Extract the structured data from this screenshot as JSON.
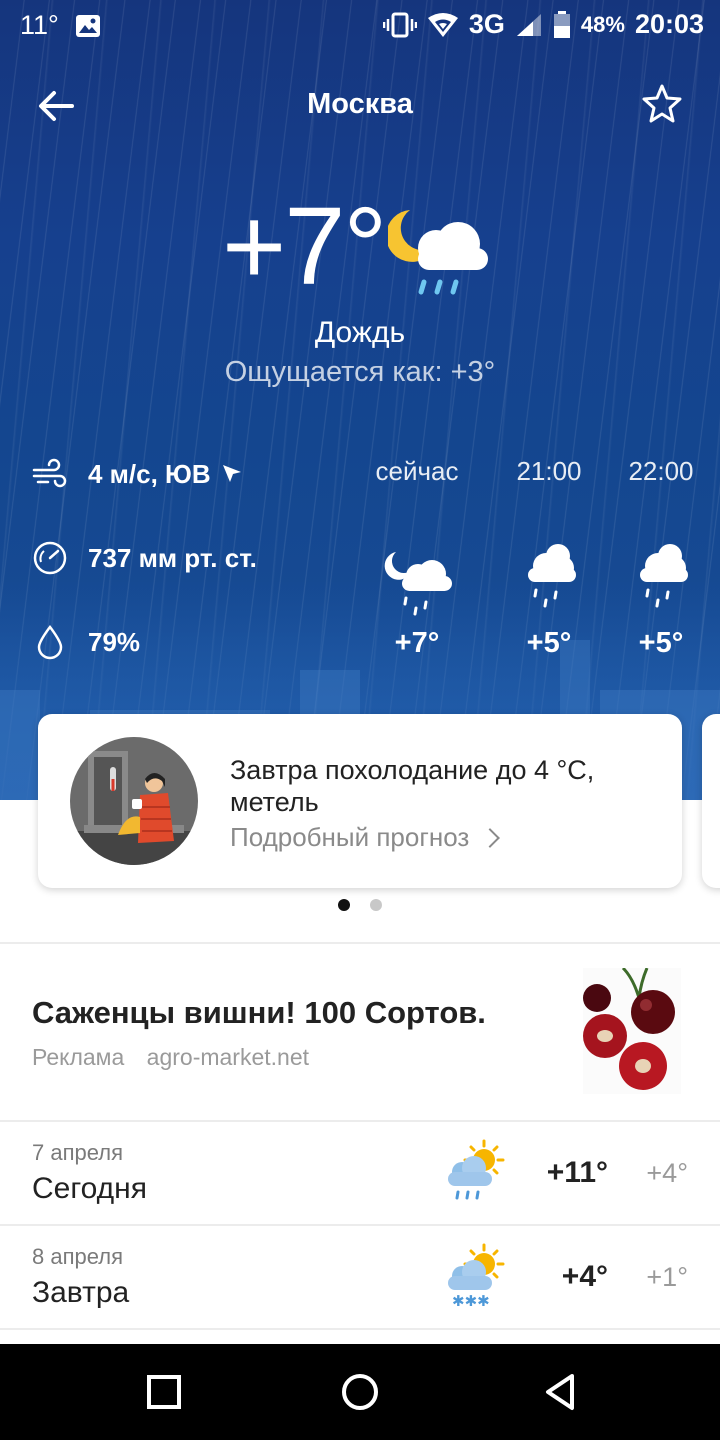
{
  "status_bar": {
    "left_temp": "11°",
    "network": "3G",
    "battery": "48%",
    "time": "20:03",
    "icons": [
      "image-icon",
      "vibrate-icon",
      "wifi-icon",
      "signal-icon",
      "battery-icon"
    ]
  },
  "header": {
    "title": "Москва",
    "back_icon": "arrow-left-icon",
    "favorite_icon": "star-outline-icon"
  },
  "current": {
    "temperature": "+7°",
    "condition": "Дождь",
    "feels_like": "Ощущается как: +3°",
    "icon": "moon-cloud-rain-icon"
  },
  "details": {
    "wind": "4 м/с, ЮВ",
    "pressure": "737 мм рт. ст.",
    "humidity": "79%"
  },
  "hourly": [
    {
      "time": "сейчас",
      "temp": "+7°",
      "icon": "moon-cloud-rain-icon"
    },
    {
      "time": "21:00",
      "temp": "+5°",
      "icon": "cloud-rain-icon"
    },
    {
      "time": "22:00",
      "temp": "+5°",
      "icon": "cloud-rain-icon"
    }
  ],
  "alert_card": {
    "title": "Завтра похолодание до 4 °C, метель",
    "link": "Подробный прогноз"
  },
  "ad": {
    "title": "Саженцы вишни! 100 Сортов.",
    "label": "Реклама",
    "domain": "agro-market.net"
  },
  "daily": [
    {
      "date": "7 апреля",
      "name": "Сегодня",
      "hi": "+11°",
      "lo": "+4°",
      "icon": "sun-cloud-rain-icon"
    },
    {
      "date": "8 апреля",
      "name": "Завтра",
      "hi": "+4°",
      "lo": "+1°",
      "icon": "sun-cloud-snow-icon"
    }
  ],
  "colors": {
    "hero_top": "#15357d",
    "hero_bottom": "#1c5aa6",
    "accent_sun": "#f7b500"
  }
}
